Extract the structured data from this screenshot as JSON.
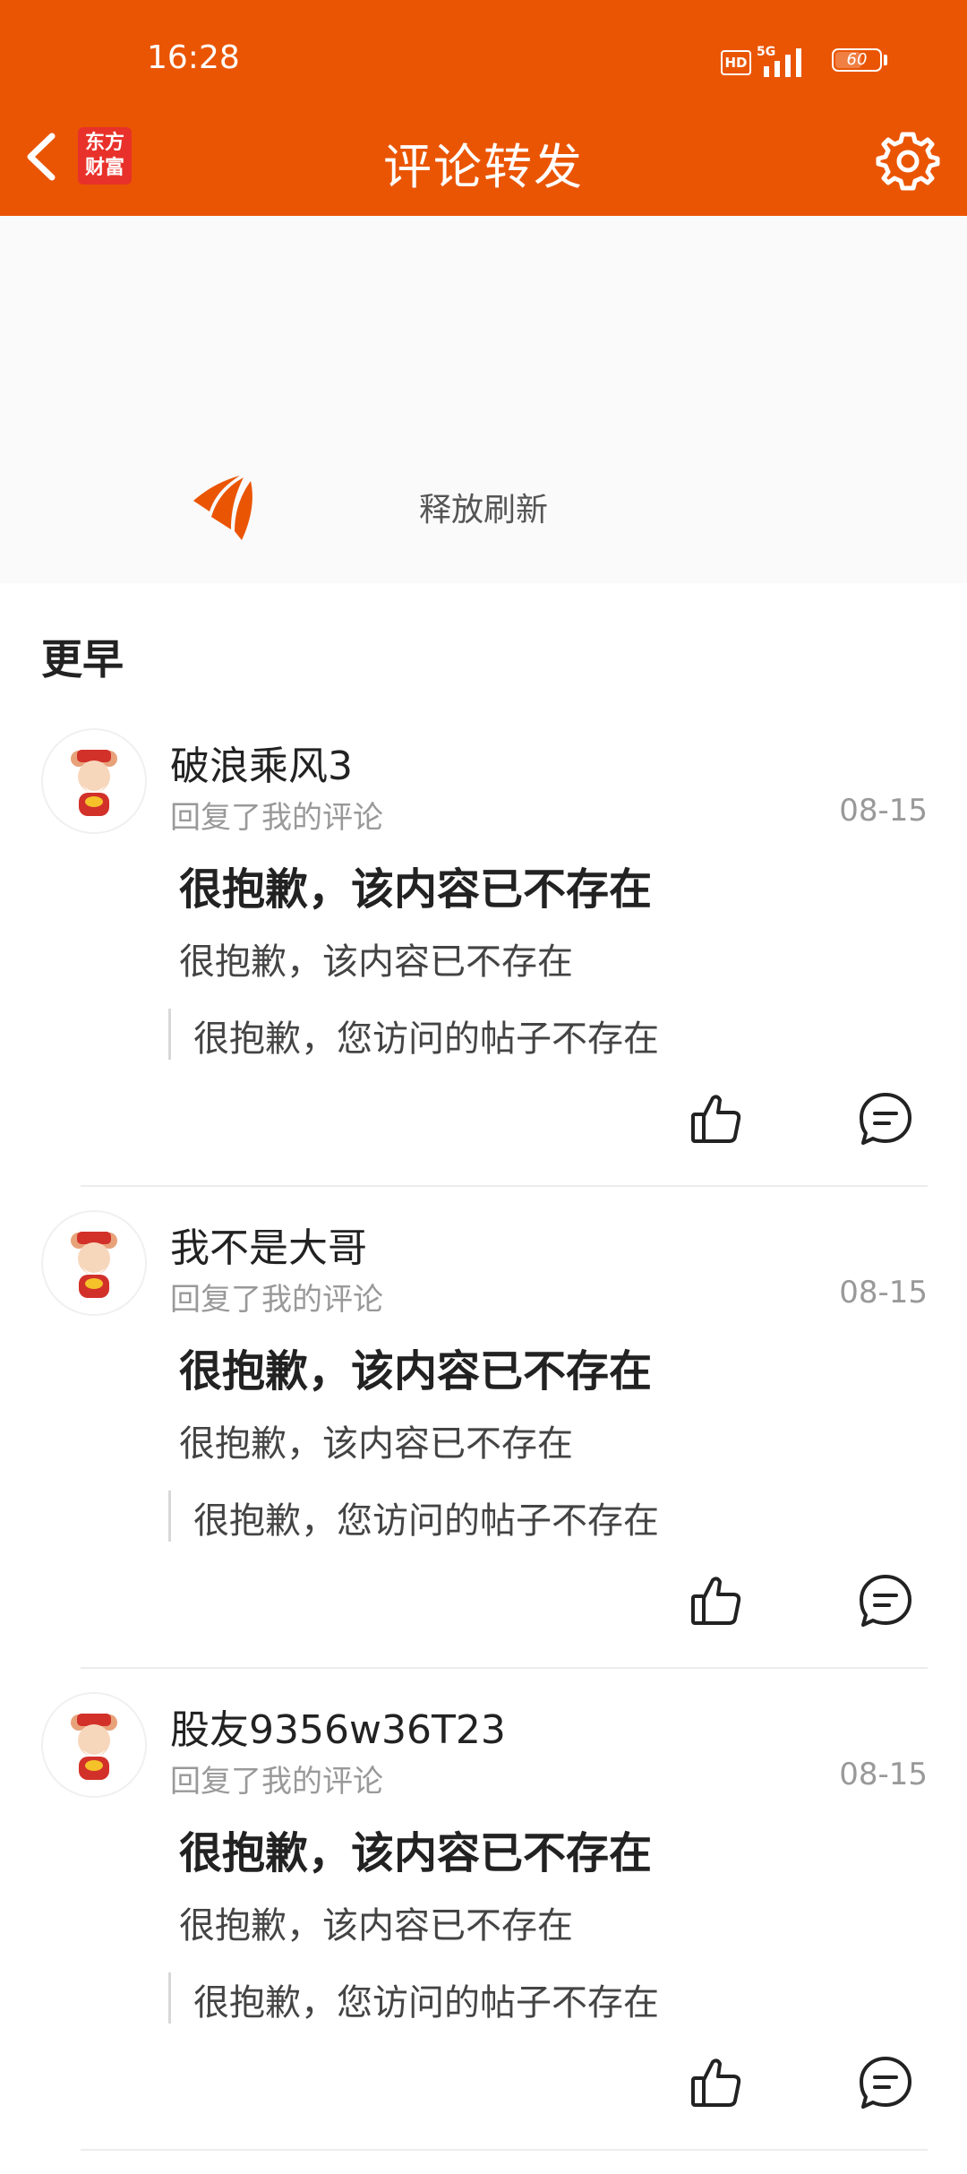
{
  "status_bar": {
    "time": "16:28",
    "hd_badge": "HD",
    "network": "5G",
    "battery": "60",
    "battery_level": 0.6
  },
  "header": {
    "title": "评论转发",
    "logo_line1": "东方",
    "logo_line2": "财富",
    "icons": {
      "back": "chevron-left-icon",
      "settings": "gear-icon"
    }
  },
  "refresh": {
    "text": "释放刷新"
  },
  "section": {
    "title": "更早"
  },
  "items": [
    {
      "username": "破浪乘风3",
      "action": "回复了我的评论",
      "date": "08-15",
      "comment": "很抱歉，该内容已不存在",
      "original_comment": "很抱歉，该内容已不存在",
      "quoted_post": "很抱歉，您访问的帖子不存在"
    },
    {
      "username": "我不是大哥",
      "action": "回复了我的评论",
      "date": "08-15",
      "comment": "很抱歉，该内容已不存在",
      "original_comment": "很抱歉，该内容已不存在",
      "quoted_post": "很抱歉，您访问的帖子不存在"
    },
    {
      "username": "股友9356w36T23",
      "action": "回复了我的评论",
      "date": "08-15",
      "comment": "很抱歉，该内容已不存在",
      "original_comment": "很抱歉，该内容已不存在",
      "quoted_post": "很抱歉，您访问的帖子不存在"
    }
  ],
  "colors": {
    "accent": "#ea5504",
    "text": "#222222",
    "muted": "#999999"
  }
}
